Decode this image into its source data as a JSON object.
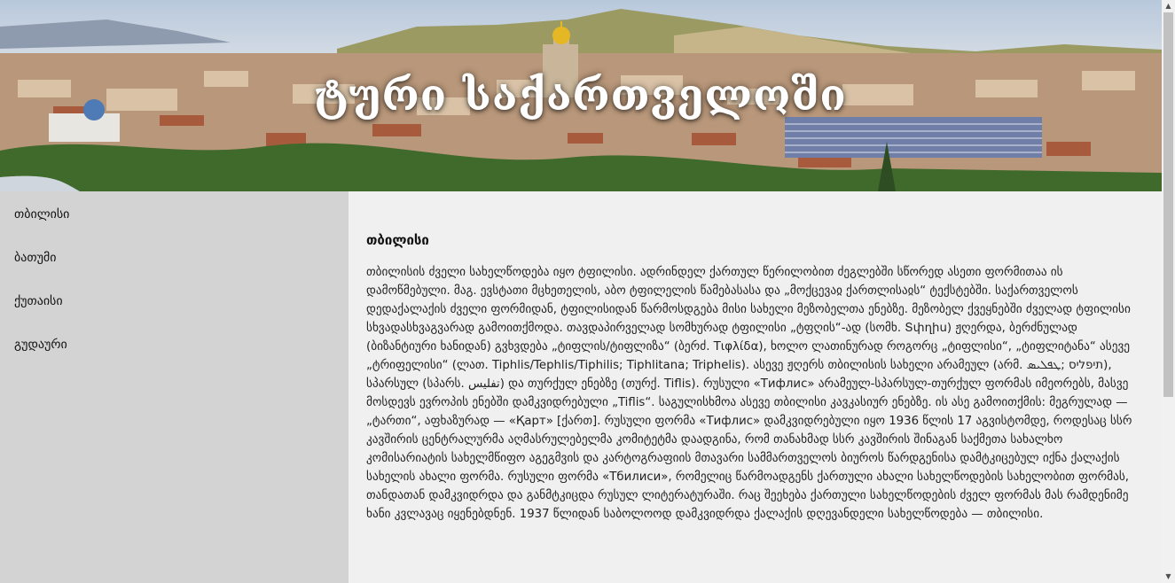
{
  "header": {
    "title": "ტური საქართველოში"
  },
  "sidebar": {
    "items": [
      {
        "label": "თბილისი"
      },
      {
        "label": "ბათუმი"
      },
      {
        "label": "ქუთაისი"
      },
      {
        "label": "გუდაური"
      }
    ]
  },
  "article": {
    "heading": "თბილისი",
    "body": "თბილისის ძველი სახელწოდება იყო ტფილისი. ადრინდელ ქართულ წერილობით ძეგლებში სწორედ ასეთი ფორმითაა ის დამოწმებული. მაგ. ევსტათი მცხეთელის, აბო ტფილელის წამებასასა და „მოქცევაჲ ქართლისაჲს“ ტექსტებში. საქართველოს დედაქალაქის ძველი ფორმიდან, ტფილისიდან წარმოსდგება მისი სახელი მეზობელთა ენებზე. მეზობელ ქვეყნებში ძველად ტფილისი სხვადასხვაგვარად გამოითქმოდა. თავდაპირველად სომხურად ტფილისი „ტფღის“-ად (სომხ. Տփղիս) ჟღერდა, ბერძნულად (ბიზანტიური ხანიდან) გვხვდება „ტიფლის/ტიფლიზა“ (ბერძ. Τιφλίδα), ხოლო ლათინურად როგორც „ტიფლისი“, „ტიფლიტანა“ ასევე „ტრიფელისი“ (ლათ. Tiphlis/Tephlis/Tiphilis; Tiphlitana; Triphelis). ასევე ჟღერს თბილისის სახელი არამეულ (არმ. תיפליס ;ܛܦܠܝܣ), სპარსულ (სპარს. تفلیس) და თურქულ ენებზე (თურქ. Tiflis). რუსული «Тифлис» არამეულ-სპარსულ-თურქულ ფორმას იმეორებს, მასვე მოსდევს ევროპის ენებში დამკვიდრებული „Tiflis“. საგულისხმოა ასევე თბილისი კავკასიურ ენებზე. ის ასე გამოითქმის: მეგრულად — „ტართი“, აფხაზურად — «Қарт» [ქართ]. რუსული ფორმა «Тифлис» დამკვიდრებული იყო 1936 წლის 17 აგვისტომდე, როდესაც სსრ კავშირის ცენტრალურმა აღმასრულებელმა კომიტეტმა დაადგინა, რომ თანახმად სსრ კავშირის შინაგან საქმეთა სახალხო კომისარიატის სახელმწიფო აგეგმვის და კარტოგრაფიის მთავარი სამმართველოს ბიუროს წარდგენისა დამტკიცებულ იქნა ქალაქის სახელის ახალი ფორმა. რუსული ფორმა «Тбилиси», რომელიც წარმოადგენს ქართული ახალი სახელწოდების სახელობით ფორმას, თანდათან დამკვიდრდა და განმტკიცდა რუსულ ლიტერატურაში. რაც შეეხება ქართული სახელწოდების ძველ ფორმას მას რამდენიმე ხანი კვლავაც იყენებდნენ. 1937 წლიდან საბოლოოდ დამკვიდრდა ქალაქის დღევანდელი სახელწოდება — თბილისი."
  },
  "colors": {
    "sidebar_bg": "#d3d3d3",
    "content_bg": "#f0f0f0",
    "title_color": "#ffffff"
  }
}
